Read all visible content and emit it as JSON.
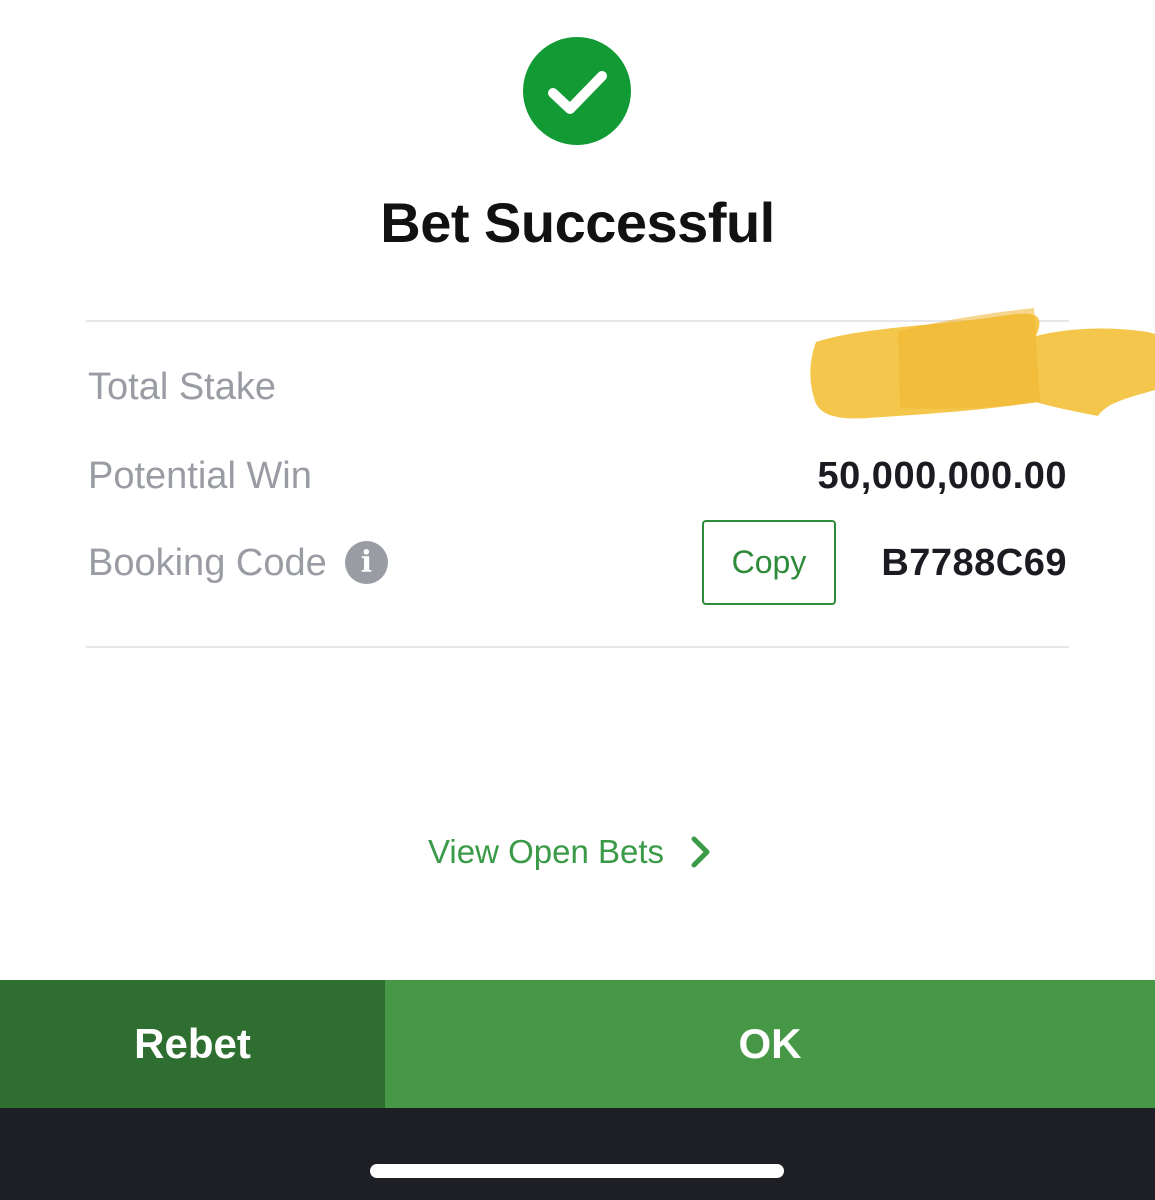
{
  "dialog": {
    "icon": "check-circle-icon",
    "title": "Bet Successful"
  },
  "summary": {
    "total_stake_label": "Total Stake",
    "total_stake_value": "",
    "potential_win_label": "Potential Win",
    "potential_win_value": "50,000,000.00",
    "booking_code_label": "Booking Code",
    "booking_code_info_icon": "info-icon",
    "copy_label": "Copy",
    "booking_code_value": "B7788C69"
  },
  "links": {
    "view_open_bets": "View Open Bets",
    "view_open_bets_icon": "chevron-right-icon"
  },
  "actions": {
    "rebet": "Rebet",
    "ok": "OK"
  },
  "colors": {
    "success_green": "#129a35",
    "accent_green": "#3a9a47",
    "rebet_bg": "#2e6e31",
    "ok_bg": "#479846",
    "redaction": "#f3c23d"
  }
}
